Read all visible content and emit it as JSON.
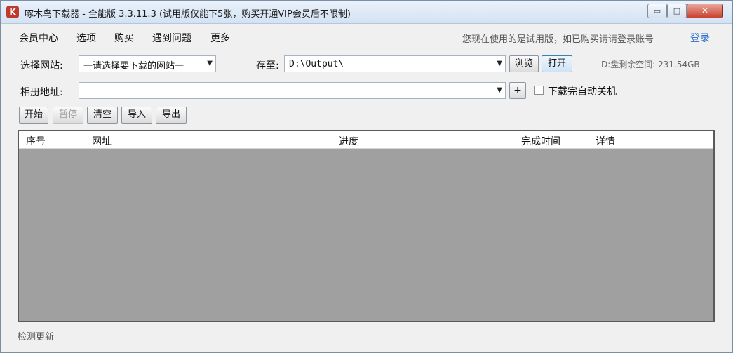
{
  "window": {
    "title": "啄木鸟下载器 - 全能版 3.3.11.3 (试用版仅能下5张，购买开通VIP会员后不限制)",
    "icon_name": "app-logo-icon",
    "controls": {
      "minimize": "▭",
      "maximize": "□",
      "close": "✕"
    }
  },
  "menu": {
    "items": [
      "会员中心",
      "选项",
      "购买",
      "遇到问题",
      "更多"
    ],
    "trial_notice": "您现在使用的是试用版，如已购买请请登录账号",
    "login": "登录"
  },
  "site_row": {
    "label": "选择网站:",
    "site_value": "一请选择要下载的网站一",
    "save_label": "存至:",
    "save_path": "D:\\Output\\",
    "browse_button": "浏览",
    "open_button": "打开",
    "disk_info": "D:盘剩余空间: 231.54GB"
  },
  "album_row": {
    "label": "相册地址:",
    "url_value": "",
    "add_button": "+",
    "auto_shutdown_label": "下载完自动关机",
    "auto_shutdown_checked": false
  },
  "toolbar": {
    "start": "开始",
    "pause": "暂停",
    "clear": "清空",
    "import": "导入",
    "export": "导出"
  },
  "table": {
    "columns": [
      "序号",
      "网址",
      "进度",
      "完成时间",
      "详情"
    ],
    "rows": []
  },
  "status": {
    "text": "检测更新"
  }
}
